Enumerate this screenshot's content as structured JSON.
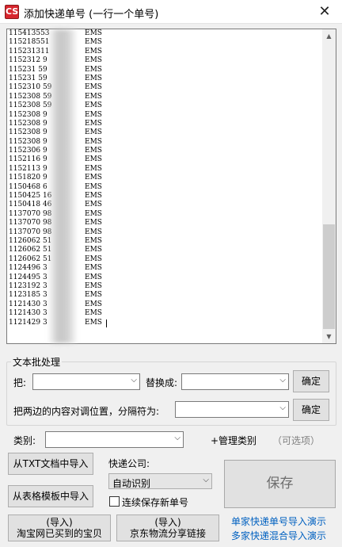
{
  "window": {
    "title": "添加快递单号 (一行一个单号)",
    "icon_label": "CS"
  },
  "lines": [
    {
      "number": "115413553",
      "carrier": "EMS"
    },
    {
      "number": "115218551",
      "carrier": "EMS"
    },
    {
      "number": "115231311",
      "carrier": "EMS"
    },
    {
      "number": "1152312  9",
      "carrier": "EMS"
    },
    {
      "number": "115231   59",
      "carrier": "EMS"
    },
    {
      "number": "115231   59",
      "carrier": "EMS"
    },
    {
      "number": "1152310  59",
      "carrier": "EMS"
    },
    {
      "number": "1152308  59",
      "carrier": "EMS"
    },
    {
      "number": "1152308  59",
      "carrier": "EMS"
    },
    {
      "number": "1152308  9",
      "carrier": "EMS"
    },
    {
      "number": "1152308  9",
      "carrier": "EMS"
    },
    {
      "number": "1152308  9",
      "carrier": "EMS"
    },
    {
      "number": "1152308  9",
      "carrier": "EMS"
    },
    {
      "number": "1152306  9",
      "carrier": "EMS"
    },
    {
      "number": "1152116  9",
      "carrier": "EMS"
    },
    {
      "number": "1152113  9",
      "carrier": "EMS"
    },
    {
      "number": "1151820  9",
      "carrier": "EMS"
    },
    {
      "number": "1150468  6",
      "carrier": "EMS"
    },
    {
      "number": "1150425  16",
      "carrier": "EMS"
    },
    {
      "number": "1150418  46",
      "carrier": "EMS"
    },
    {
      "number": "1137070  98",
      "carrier": "EMS"
    },
    {
      "number": "1137070  98",
      "carrier": "EMS"
    },
    {
      "number": "1137070  98",
      "carrier": "EMS"
    },
    {
      "number": "1126062  51",
      "carrier": "EMS"
    },
    {
      "number": "1126062  51",
      "carrier": "EMS"
    },
    {
      "number": "1126062  51",
      "carrier": "EMS"
    },
    {
      "number": "1124496  3",
      "carrier": "EMS"
    },
    {
      "number": "1124495  3",
      "carrier": "EMS"
    },
    {
      "number": "1123192  3",
      "carrier": "EMS"
    },
    {
      "number": "1123185  3",
      "carrier": "EMS"
    },
    {
      "number": "1121430  3",
      "carrier": "EMS"
    },
    {
      "number": "1121430  3",
      "carrier": "EMS"
    },
    {
      "number": "1121429  3",
      "carrier": "EMS"
    }
  ],
  "batch": {
    "group_title": "文本批处理",
    "replace_from_label": "把:",
    "replace_from_value": "",
    "replace_to_label": "替换成:",
    "replace_to_value": "",
    "confirm_label": "确定",
    "swap_label": "把两边的内容对调位置，分隔符为:",
    "swap_sep_value": "",
    "confirm2_label": "确定"
  },
  "category": {
    "label": "类别:",
    "value": "",
    "manage_label": "+管理类别",
    "optional_label": "（可选项）"
  },
  "imports": {
    "txt_label": "从TXT文档中导入",
    "excel_label": "从表格模板中导入",
    "taobao_line1": "(导入)",
    "taobao_line2": "淘宝网已买到的宝贝",
    "jd_line1": "(导入)",
    "jd_line2": "京东物流分享链接"
  },
  "courier": {
    "label": "快递公司:",
    "value": "自动识别",
    "continuous_label": "连续保存新单号",
    "continuous_checked": false
  },
  "save_label": "保存",
  "links": {
    "single_demo": "单家快递单号导入演示",
    "multi_demo": "多家快递混合导入演示"
  }
}
